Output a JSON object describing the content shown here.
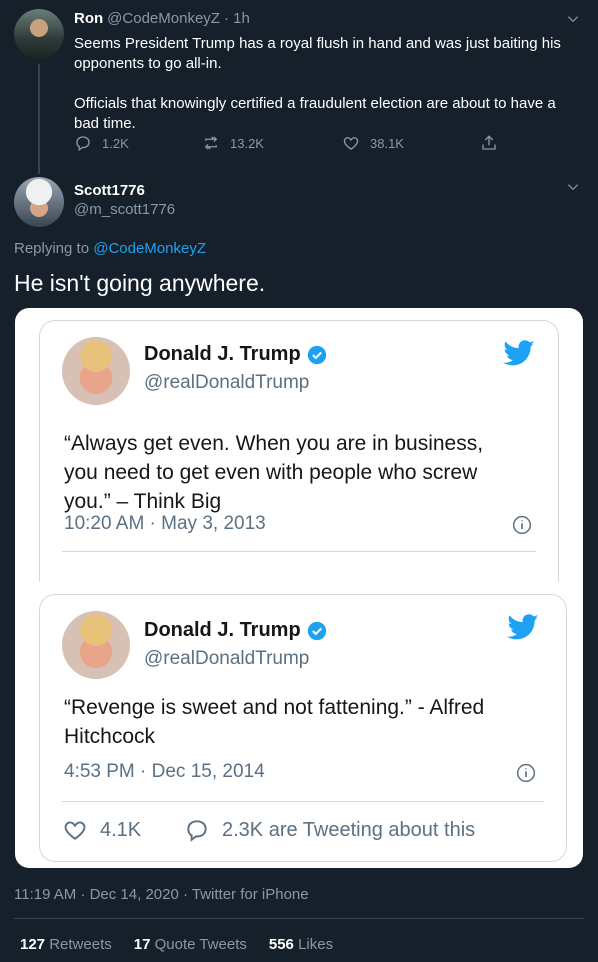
{
  "parent_tweet": {
    "name": "Ron",
    "handle": "@CodeMonkeyZ",
    "time": "· 1h",
    "line1": "Seems President Trump has a royal flush in hand and was just baiting his",
    "line2": "opponents to go all-in.",
    "line3": "Officials that knowingly certified a fraudulent election are about to have a",
    "line4": "bad time.",
    "replies": "1.2K",
    "retweets": "13.2K",
    "likes": "38.1K"
  },
  "reply_tweet": {
    "name": "Scott1776",
    "handle": "@m_scott1776",
    "replying_prefix": "Replying to",
    "replying_to": "@CodeMonkeyZ",
    "text": "He isn't going anywhere.",
    "timestamp": "11:19 AM · Dec 14, 2020 · Twitter for iPhone",
    "retweets_count": "127",
    "retweets_label": "Retweets",
    "quotes_count": "17",
    "quotes_label": "Quote Tweets",
    "likes_count": "556",
    "likes_label": "Likes"
  },
  "embedded": {
    "tweet1": {
      "name": "Donald J. Trump",
      "handle": "@realDonaldTrump",
      "line1": "“Always get even. When you are in business,",
      "line2": "you need to get even with people who screw",
      "line3": "you.” – Think Big",
      "time": "10:20 AM · May 3, 2013"
    },
    "tweet2": {
      "name": "Donald J. Trump",
      "handle": "@realDonaldTrump",
      "line1": "“Revenge is sweet and not fattening.” - Alfred",
      "line2": "Hitchcock",
      "time": "4:53 PM · Dec 15, 2014",
      "likes": "4.1K",
      "tweeting": "2.3K are Tweeting about this"
    }
  },
  "colors": {
    "background": "#15202b",
    "accent": "#1da1f2",
    "muted": "#8899a6"
  }
}
